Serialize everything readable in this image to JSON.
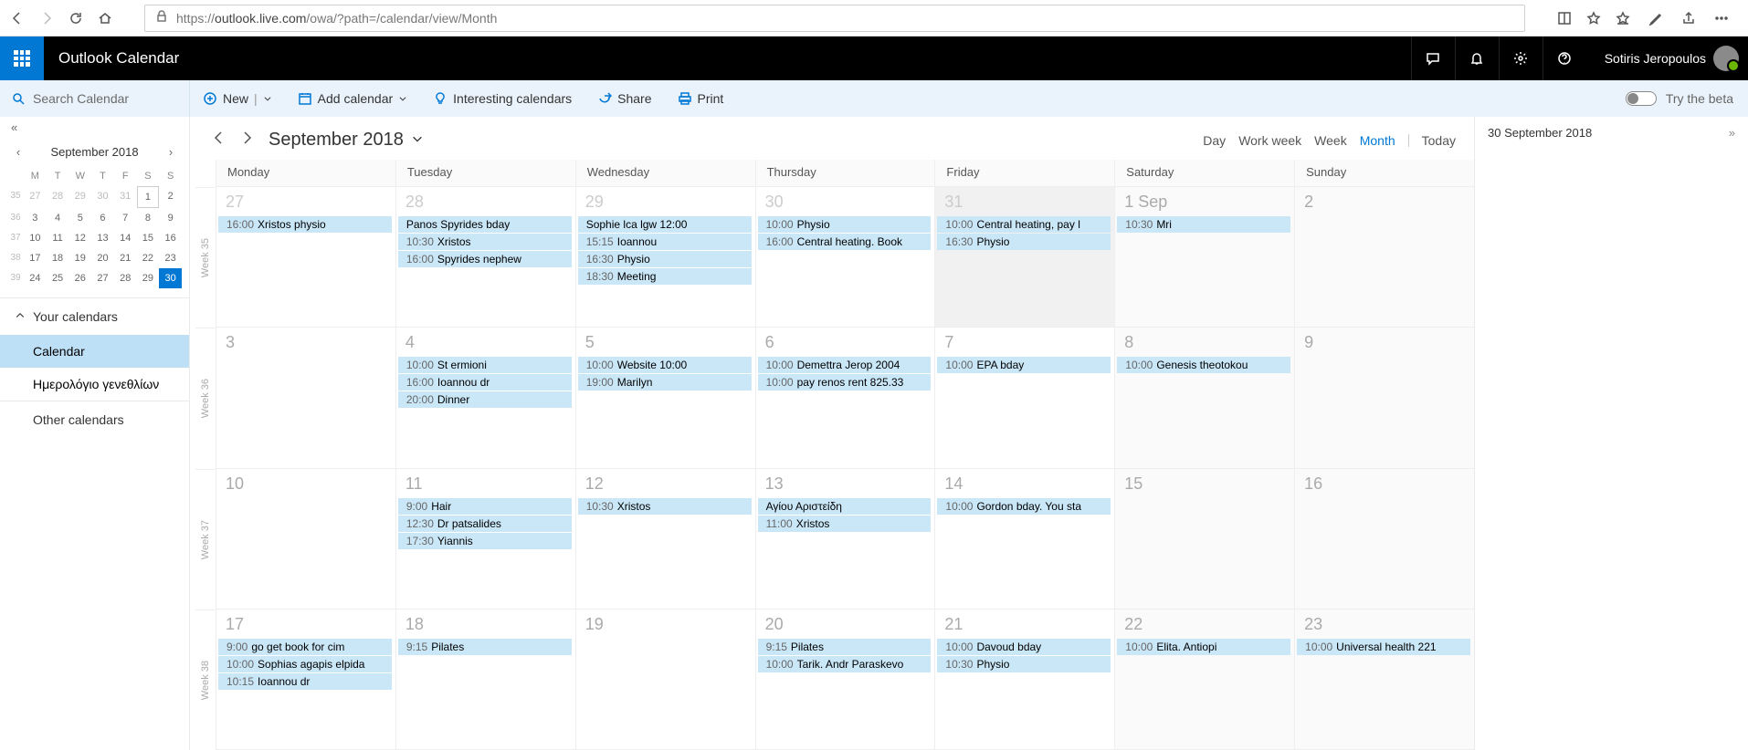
{
  "browser": {
    "url_prefix": "https://",
    "url_host": "outlook.live.com",
    "url_path": "/owa/?path=/calendar/view/Month"
  },
  "header": {
    "app_title": "Outlook Calendar",
    "user_name": "Sotiris Jeropoulos"
  },
  "cmdbar": {
    "search_placeholder": "Search Calendar",
    "new": "New",
    "add_calendar": "Add calendar",
    "interesting": "Interesting calendars",
    "share": "Share",
    "print": "Print",
    "try_beta": "Try the beta"
  },
  "mini": {
    "title": "September 2018",
    "dow": [
      "M",
      "T",
      "W",
      "T",
      "F",
      "S",
      "S"
    ],
    "weeks": [
      {
        "wn": "35",
        "days": [
          {
            "n": "27",
            "cls": "prev"
          },
          {
            "n": "28",
            "cls": "prev"
          },
          {
            "n": "29",
            "cls": "prev"
          },
          {
            "n": "30",
            "cls": "prev"
          },
          {
            "n": "31",
            "cls": "prev"
          },
          {
            "n": "1",
            "cls": "box"
          },
          {
            "n": "2",
            "cls": ""
          }
        ]
      },
      {
        "wn": "36",
        "days": [
          {
            "n": "3"
          },
          {
            "n": "4"
          },
          {
            "n": "5"
          },
          {
            "n": "6"
          },
          {
            "n": "7"
          },
          {
            "n": "8"
          },
          {
            "n": "9"
          }
        ]
      },
      {
        "wn": "37",
        "days": [
          {
            "n": "10"
          },
          {
            "n": "11"
          },
          {
            "n": "12"
          },
          {
            "n": "13"
          },
          {
            "n": "14"
          },
          {
            "n": "15"
          },
          {
            "n": "16"
          }
        ]
      },
      {
        "wn": "38",
        "days": [
          {
            "n": "17"
          },
          {
            "n": "18"
          },
          {
            "n": "19"
          },
          {
            "n": "20"
          },
          {
            "n": "21"
          },
          {
            "n": "22"
          },
          {
            "n": "23"
          }
        ]
      },
      {
        "wn": "39",
        "days": [
          {
            "n": "24"
          },
          {
            "n": "25"
          },
          {
            "n": "26"
          },
          {
            "n": "27"
          },
          {
            "n": "28"
          },
          {
            "n": "29"
          },
          {
            "n": "30",
            "cls": "today"
          }
        ]
      }
    ]
  },
  "sidebar": {
    "your_calendars": "Your calendars",
    "calendar": "Calendar",
    "birthdays": "Ημερολόγιο γενεθλίων",
    "other": "Other calendars"
  },
  "calhead": {
    "month": "September 2018",
    "views": {
      "day": "Day",
      "workweek": "Work week",
      "week": "Week",
      "month": "Month",
      "today": "Today"
    }
  },
  "agenda": {
    "date": "30 September 2018"
  },
  "dow_full": [
    "Monday",
    "Tuesday",
    "Wednesday",
    "Thursday",
    "Friday",
    "Saturday",
    "Sunday"
  ],
  "week_labels": [
    "Week 35",
    "Week 36",
    "Week 37",
    "Week 38"
  ],
  "weeks": [
    [
      {
        "num": "27",
        "out": true,
        "events": [
          {
            "t": "16:00",
            "s": "Xristos physio"
          }
        ]
      },
      {
        "num": "28",
        "out": true,
        "events": [
          {
            "t": "",
            "s": "Panos Spyrides bday"
          },
          {
            "t": "10:30",
            "s": "Xristos"
          },
          {
            "t": "16:00",
            "s": "Spyrides nephew"
          }
        ]
      },
      {
        "num": "29",
        "out": true,
        "events": [
          {
            "t": "",
            "s": "Sophie lca lgw 12:00"
          },
          {
            "t": "15:15",
            "s": "Ioannou"
          },
          {
            "t": "16:30",
            "s": "Physio"
          },
          {
            "t": "18:30",
            "s": "Meeting"
          }
        ]
      },
      {
        "num": "30",
        "out": true,
        "events": [
          {
            "t": "10:00",
            "s": "Physio"
          },
          {
            "t": "16:00",
            "s": "Central heating. Book"
          }
        ]
      },
      {
        "num": "31",
        "out": true,
        "grey": true,
        "events": [
          {
            "t": "10:00",
            "s": "Central heating, pay l"
          },
          {
            "t": "16:30",
            "s": "Physio"
          }
        ]
      },
      {
        "num": "1 Sep",
        "weekend": true,
        "events": [
          {
            "t": "10:30",
            "s": "Mri"
          }
        ]
      },
      {
        "num": "2",
        "weekend": true,
        "events": []
      }
    ],
    [
      {
        "num": "3",
        "events": []
      },
      {
        "num": "4",
        "events": [
          {
            "t": "10:00",
            "s": "St ermioni"
          },
          {
            "t": "16:00",
            "s": "Ioannou dr"
          },
          {
            "t": "20:00",
            "s": "Dinner"
          }
        ]
      },
      {
        "num": "5",
        "events": [
          {
            "t": "10:00",
            "s": "Website 10:00"
          },
          {
            "t": "19:00",
            "s": "Marilyn"
          }
        ]
      },
      {
        "num": "6",
        "events": [
          {
            "t": "10:00",
            "s": "Demettra Jerop 2004"
          },
          {
            "t": "10:00",
            "s": "pay renos rent 825.33"
          }
        ]
      },
      {
        "num": "7",
        "events": [
          {
            "t": "10:00",
            "s": "EPA bday"
          }
        ]
      },
      {
        "num": "8",
        "weekend": true,
        "events": [
          {
            "t": "10:00",
            "s": "Genesis theotokou"
          }
        ]
      },
      {
        "num": "9",
        "weekend": true,
        "events": []
      }
    ],
    [
      {
        "num": "10",
        "events": []
      },
      {
        "num": "11",
        "events": [
          {
            "t": "9:00",
            "s": "Hair"
          },
          {
            "t": "12:30",
            "s": "Dr patsalides"
          },
          {
            "t": "17:30",
            "s": "Yiannis"
          }
        ]
      },
      {
        "num": "12",
        "events": [
          {
            "t": "10:30",
            "s": "Xristos"
          }
        ]
      },
      {
        "num": "13",
        "events": [
          {
            "t": "",
            "s": "Αγίου Αριστείδη"
          },
          {
            "t": "11:00",
            "s": "Xristos"
          }
        ]
      },
      {
        "num": "14",
        "events": [
          {
            "t": "10:00",
            "s": "Gordon bday. You sta"
          }
        ]
      },
      {
        "num": "15",
        "weekend": true,
        "events": []
      },
      {
        "num": "16",
        "weekend": true,
        "events": []
      }
    ],
    [
      {
        "num": "17",
        "events": [
          {
            "t": "9:00",
            "s": "go get book for cim"
          },
          {
            "t": "10:00",
            "s": "Sophias agapis elpida"
          },
          {
            "t": "10:15",
            "s": "Ioannou dr"
          }
        ]
      },
      {
        "num": "18",
        "events": [
          {
            "t": "9:15",
            "s": "Pilates"
          }
        ]
      },
      {
        "num": "19",
        "events": []
      },
      {
        "num": "20",
        "events": [
          {
            "t": "9:15",
            "s": "Pilates"
          },
          {
            "t": "10:00",
            "s": "Tarik. Andr Paraskevo"
          }
        ]
      },
      {
        "num": "21",
        "events": [
          {
            "t": "10:00",
            "s": "Davoud bday"
          },
          {
            "t": "10:30",
            "s": "Physio"
          }
        ]
      },
      {
        "num": "22",
        "weekend": true,
        "events": [
          {
            "t": "10:00",
            "s": "Elita. Antiopi"
          }
        ]
      },
      {
        "num": "23",
        "weekend": true,
        "events": [
          {
            "t": "10:00",
            "s": "Universal health 221"
          }
        ]
      }
    ]
  ]
}
